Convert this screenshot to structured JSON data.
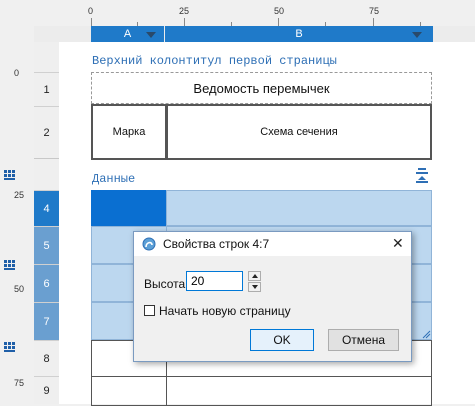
{
  "ruler": {
    "top_numbers": [
      "0",
      "25",
      "50",
      "75"
    ],
    "left_numbers": [
      "0",
      "25",
      "50",
      "75"
    ]
  },
  "columns": [
    {
      "label": "A"
    },
    {
      "label": "B"
    }
  ],
  "rows": [
    "1",
    "2",
    "4",
    "5",
    "6",
    "7",
    "8",
    "9"
  ],
  "header_band": {
    "title": "Верхний колонтитул первой страницы"
  },
  "table": {
    "title": "Ведомость перемычек",
    "col1": "Марка",
    "col2": "Схема сечения"
  },
  "data_band": {
    "title": "Данные"
  },
  "dialog": {
    "title": "Свойства строк 4:7",
    "height_label": "Высота",
    "height_value": "20",
    "newpage_label": "Начать новую страницу",
    "ok": "OK",
    "cancel": "Отмена"
  },
  "colors": {
    "accent": "#1f7ac9",
    "selection": "#bcd7ef",
    "band_text": "#2e6fb5"
  }
}
